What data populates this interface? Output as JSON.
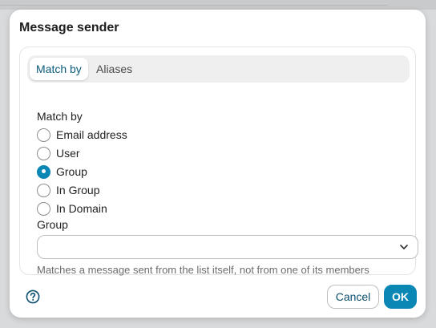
{
  "dialog": {
    "title": "Message sender",
    "tabs": [
      {
        "label": "Match by",
        "active": true
      },
      {
        "label": "Aliases",
        "active": false
      }
    ],
    "match_by_label": "Match by",
    "options": [
      {
        "label": "Email address",
        "checked": false
      },
      {
        "label": "User",
        "checked": false
      },
      {
        "label": "Group",
        "checked": true
      },
      {
        "label": "In Group",
        "checked": false
      },
      {
        "label": "In Domain",
        "checked": false
      }
    ],
    "group_label": "Group",
    "group_value": "",
    "help_text": "Matches a message sent from the list itself, not from one of its members",
    "cancel_label": "Cancel",
    "ok_label": "OK"
  },
  "colors": {
    "accent": "#0a87b5",
    "title_text": "#1e1e1e",
    "muted_text": "#6b6c6e"
  },
  "icons": {
    "help": "question-circle-icon",
    "dropdown": "chevron-down-icon"
  }
}
